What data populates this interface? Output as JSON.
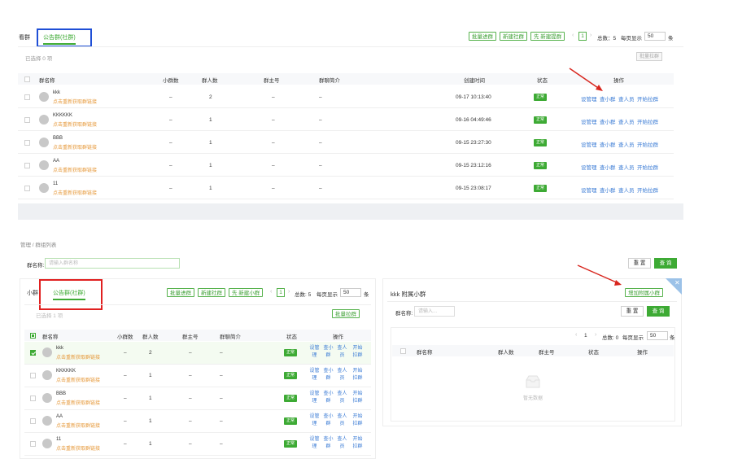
{
  "top": {
    "tabs": [
      {
        "label": "看群"
      },
      {
        "label": "公告群(社群)"
      }
    ],
    "toolbar": {
      "batch_add": "批量进群",
      "create": "新建社群",
      "create_sub": "先 新建提群"
    },
    "pager": {
      "prev": "‹",
      "page": "1",
      "next": "›",
      "total": "总数：5",
      "page_size_label": "每页显示",
      "page_size": "50",
      "unit": "条"
    },
    "selected": "已选择 0 项",
    "batch_pull": "批量拉群",
    "headers": [
      "群名称",
      "小群数",
      "群人数",
      "群主号",
      "群聊简介",
      "创建时间",
      "状态",
      "操作"
    ],
    "rows": [
      {
        "name": "kkk",
        "link": "点击重新获取群链接",
        "sub": "–",
        "members": "2",
        "owner": "–",
        "intro": "–",
        "time": "09-17 10:13:40",
        "status": "正常",
        "actions": [
          "设管理",
          "查小群",
          "查人员",
          "开始拉群"
        ]
      },
      {
        "name": "KKKKKK",
        "link": "点击重新获取群链接",
        "sub": "–",
        "members": "1",
        "owner": "–",
        "intro": "–",
        "time": "09-16 04:49:46",
        "status": "正常",
        "actions": [
          "设管理",
          "查小群",
          "查人员",
          "开始拉群"
        ]
      },
      {
        "name": "BBB",
        "link": "点击重新获取群链接",
        "sub": "–",
        "members": "1",
        "owner": "–",
        "intro": "–",
        "time": "09-15 23:27:30",
        "status": "正常",
        "actions": [
          "设管理",
          "查小群",
          "查人员",
          "开始拉群"
        ]
      },
      {
        "name": "AA",
        "link": "点击重新获取群链接",
        "sub": "–",
        "members": "1",
        "owner": "–",
        "intro": "–",
        "time": "09-15 23:12:16",
        "status": "正常",
        "actions": [
          "设管理",
          "查小群",
          "查人员",
          "开始拉群"
        ]
      },
      {
        "name": "11",
        "link": "点击重新获取群链接",
        "sub": "–",
        "members": "1",
        "owner": "–",
        "intro": "–",
        "time": "09-15 23:08:17",
        "status": "正常",
        "actions": [
          "设管理",
          "查小群",
          "查人员",
          "开始拉群"
        ]
      }
    ]
  },
  "bottom": {
    "breadcrumb": "管理 / 群组列表",
    "search_label": "群名称:",
    "search_placeholder": "请输入群名称",
    "reset": "重 置",
    "query": "查 询",
    "tabs": [
      {
        "label": "小群"
      },
      {
        "label": "公告群(社群)"
      }
    ],
    "toolbar": {
      "batch_add": "批量进群",
      "create": "新建社群",
      "create_sub": "先 新建小群"
    },
    "pager": {
      "prev": "‹",
      "page": "1",
      "next": "›",
      "total": "总数: 5",
      "page_size_label": "每页显示",
      "page_size": "50",
      "unit": "条"
    },
    "selected": "已选择 1 项",
    "batch_pull": "批量拉群",
    "headers": [
      "群名称",
      "小群数",
      "群人数",
      "群主号",
      "群聊简介",
      "状态",
      "操作"
    ],
    "rows": [
      {
        "name": "kkk",
        "link": "点击重新获取群链接",
        "sub": "–",
        "members": "2",
        "owner": "–",
        "intro": "–",
        "status": "正常",
        "actions": [
          [
            "设管",
            "理"
          ],
          [
            "查小",
            "群"
          ],
          [
            "查人",
            "员"
          ],
          [
            "开始",
            "拉群"
          ]
        ]
      },
      {
        "name": "KKKKKK",
        "link": "点击重新获取群链接",
        "sub": "–",
        "members": "1",
        "owner": "–",
        "intro": "–",
        "status": "正常",
        "actions": [
          [
            "设管",
            "理"
          ],
          [
            "查小",
            "群"
          ],
          [
            "查人",
            "员"
          ],
          [
            "开始",
            "拉群"
          ]
        ]
      },
      {
        "name": "BBB",
        "link": "点击重新获取群链接",
        "sub": "–",
        "members": "1",
        "owner": "–",
        "intro": "–",
        "status": "正常",
        "actions": [
          [
            "设管",
            "理"
          ],
          [
            "查小",
            "群"
          ],
          [
            "查人",
            "员"
          ],
          [
            "开始",
            "拉群"
          ]
        ]
      },
      {
        "name": "AA",
        "link": "点击重新获取群链接",
        "sub": "–",
        "members": "1",
        "owner": "–",
        "intro": "–",
        "status": "正常",
        "actions": [
          [
            "设管",
            "理"
          ],
          [
            "查小",
            "群"
          ],
          [
            "查人",
            "员"
          ],
          [
            "开始",
            "拉群"
          ]
        ]
      },
      {
        "name": "11",
        "link": "点击重新获取群链接",
        "sub": "–",
        "members": "1",
        "owner": "–",
        "intro": "–",
        "status": "正常",
        "actions": [
          [
            "设管",
            "理"
          ],
          [
            "查小",
            "群"
          ],
          [
            "查人",
            "员"
          ],
          [
            "开始",
            "拉群"
          ]
        ]
      }
    ],
    "side": {
      "title": "kkk 附属小群",
      "add_btn": "增加附属小群",
      "search_label": "群名称:",
      "search_placeholder": "请输入...",
      "reset": "重 置",
      "query": "查 询",
      "pager": {
        "prev": "‹",
        "page": "1",
        "next": "›",
        "total": "总数: 0",
        "page_size_label": "每页显示",
        "page_size": "50",
        "unit": "条"
      },
      "headers": [
        "群名称",
        "群人数",
        "群主号",
        "状态",
        "操作"
      ],
      "empty": "暂无数据"
    }
  },
  "colors": {
    "accent": "#3daa34",
    "link": "#3a7bd5",
    "orange": "#e6993a",
    "highlight_blue": "#1f4fd6",
    "highlight_red": "#e02020",
    "arrow": "#d8261e"
  }
}
